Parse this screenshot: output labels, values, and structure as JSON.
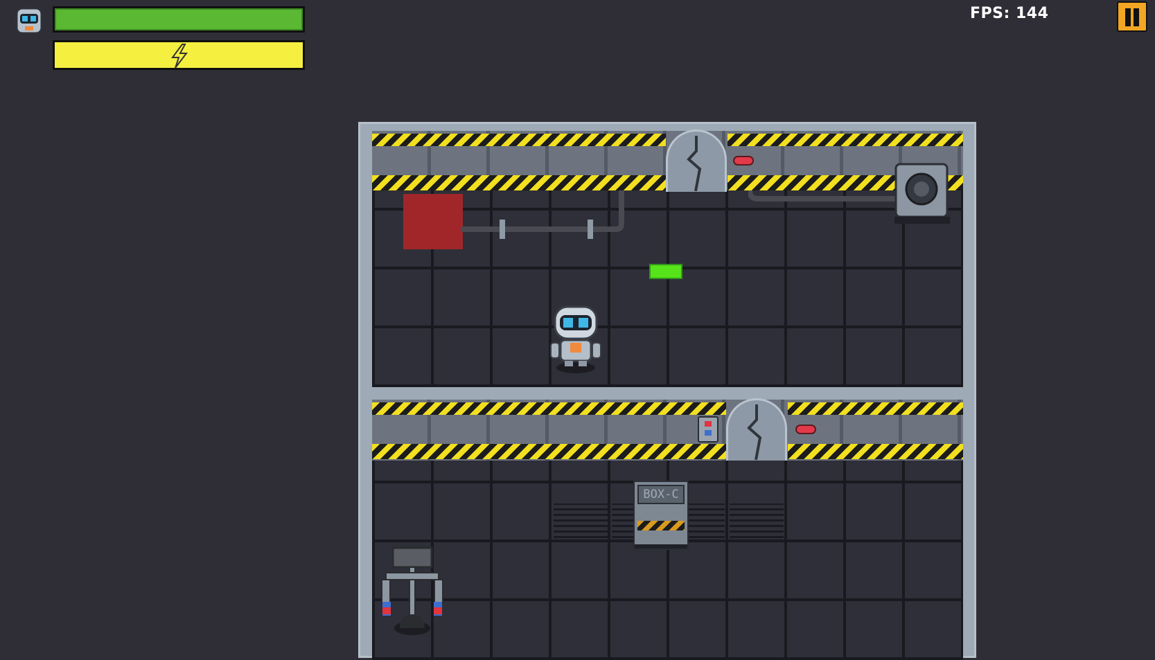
{
  "hud": {
    "fps_label": "FPS: 144",
    "health_level": 1.0,
    "energy_level": 1.0,
    "pause_icon": "pause-icon",
    "energy_icon": "lightning-icon",
    "avatar_icon": "robot-avatar-icon"
  },
  "scene": {
    "crate_label": "BOX-C"
  },
  "colors": {
    "health": "#5ab832",
    "energy": "#f5f040",
    "pause_button": "#f2a623",
    "background": "#2f2e36"
  }
}
